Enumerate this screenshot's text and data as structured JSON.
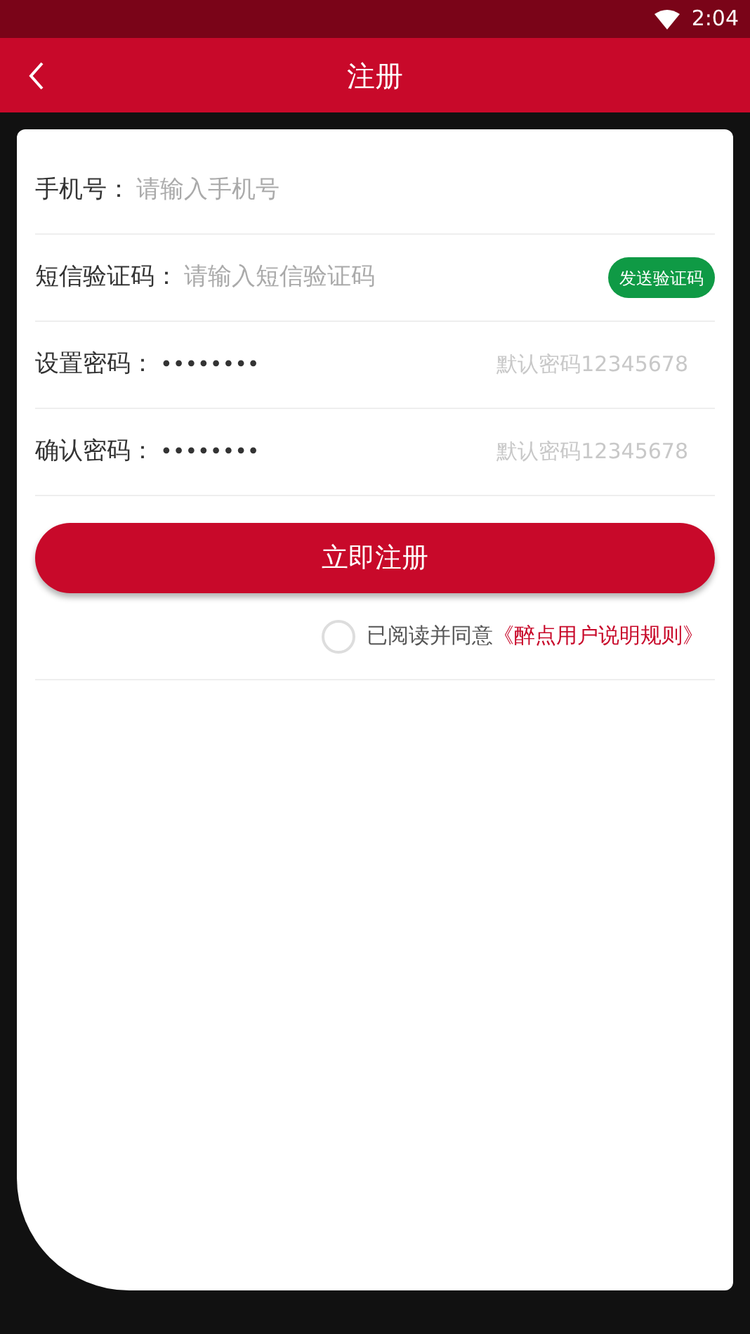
{
  "status_bar": {
    "time": "2:04"
  },
  "header": {
    "title": "注册"
  },
  "fields": [
    {
      "kind": "text",
      "label": "手机号：",
      "placeholder": "请输入手机号"
    },
    {
      "kind": "code",
      "label": "短信验证码：",
      "placeholder": "请输入短信验证码",
      "button": "发送验证码"
    },
    {
      "kind": "password",
      "label": "设置密码：",
      "value": "••••••••",
      "hint": "默认密码12345678"
    },
    {
      "kind": "password",
      "label": "确认密码：",
      "value": "••••••••",
      "hint": "默认密码12345678"
    }
  ],
  "submit": "立即注册",
  "agreement": {
    "checked": false,
    "text": "已阅读并同意",
    "link": "《醉点用户说明规则》"
  }
}
